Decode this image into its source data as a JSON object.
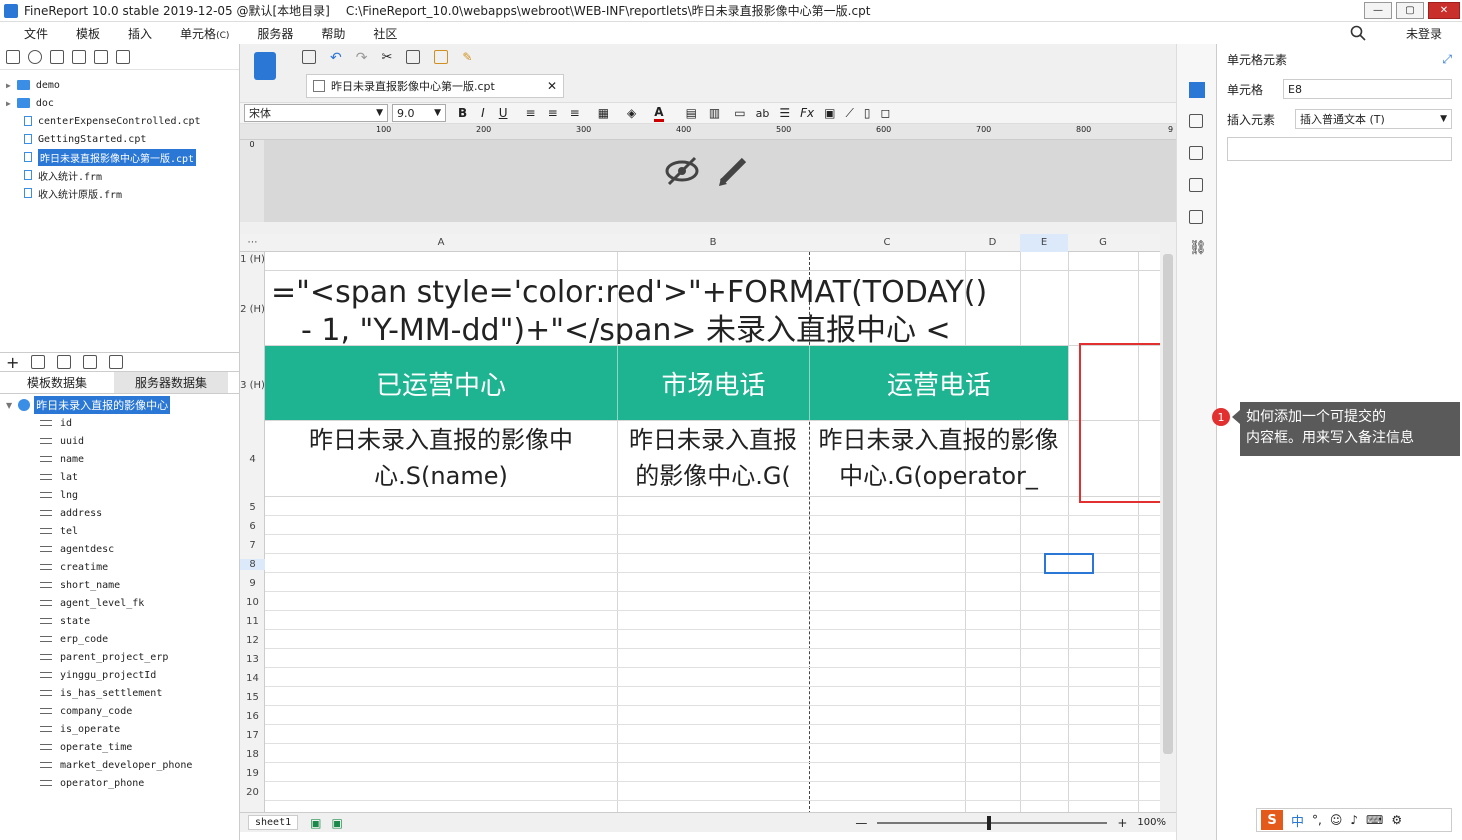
{
  "titlebar": {
    "app": "FineReport 10.0 stable 2019-12-05 @默认[本地目录]",
    "path": "C:\\FineReport_10.0\\webapps\\webroot\\WEB-INF\\reportlets\\昨日未录直报影像中心第一版.cpt"
  },
  "menu": [
    "文件",
    "模板",
    "插入",
    "单元格",
    "服务器",
    "帮助",
    "社区"
  ],
  "menu_shortcut": "(C)",
  "login": "未登录",
  "file_tree": [
    {
      "label": "demo",
      "type": "folder"
    },
    {
      "label": "doc",
      "type": "folder"
    },
    {
      "label": "centerExpenseControlled.cpt",
      "type": "file"
    },
    {
      "label": "GettingStarted.cpt",
      "type": "file"
    },
    {
      "label": "昨日未录直报影像中心第一版.cpt",
      "type": "file",
      "selected": true
    },
    {
      "label": "收入统计.frm",
      "type": "file"
    },
    {
      "label": "收入统计原版.frm",
      "type": "file"
    }
  ],
  "dataset_tabs": [
    "模板数据集",
    "服务器数据集"
  ],
  "dataset": {
    "name": "昨日未录入直报的影像中心",
    "fields": [
      "id",
      "uuid",
      "name",
      "lat",
      "lng",
      "address",
      "tel",
      "agentdesc",
      "creatime",
      "short_name",
      "agent_level_fk",
      "state",
      "erp_code",
      "parent_project_erp",
      "yinggu_projectId",
      "is_has_settlement",
      "company_code",
      "is_operate",
      "operate_time",
      "market_developer_phone",
      "operator_phone"
    ]
  },
  "doc_tab": "昨日未录直报影像中心第一版.cpt",
  "format": {
    "font": "宋体",
    "size": "9.0"
  },
  "ruler": [
    "100",
    "200",
    "300",
    "400",
    "500",
    "600",
    "700",
    "800",
    "9"
  ],
  "ruler_v": "0",
  "columns": [
    "A",
    "B",
    "C",
    "D",
    "E",
    "G"
  ],
  "rows": [
    "1 (H)",
    "2 (H)",
    "3 (H)",
    "4",
    "5",
    "6",
    "7",
    "8",
    "9",
    "10",
    "11",
    "12",
    "13",
    "14",
    "15",
    "16",
    "17",
    "18",
    "19",
    "20"
  ],
  "cells": {
    "formula_line1": "=\"<span style='color:red'>\"+FORMAT(TODAY()",
    "formula_line2": "- 1, \"Y-MM-dd\")+\"</span> 未录入直报中心 <",
    "h_a": "已运营中心",
    "h_b": "市场电话",
    "h_c": "运营电话",
    "d_a": "昨日未录入直报的影像中心.S(name)",
    "d_b": "昨日未录入直报的影像中心.G(",
    "d_c": "昨日未录入直报的影像中心.G(operator_"
  },
  "sheet": "sheet1",
  "zoom": "100%",
  "right_panel": {
    "title": "单元格元素",
    "cell_label": "单元格",
    "cell_value": "E8",
    "insert_label": "插入元素",
    "insert_value": "插入普通文本 (T)"
  },
  "annotation": {
    "num": "1",
    "text_line1": "如何添加一个可提交的",
    "text_line2": "内容框。用来写入备注信息"
  },
  "accent": "#1eb391",
  "tray_ime": "中"
}
